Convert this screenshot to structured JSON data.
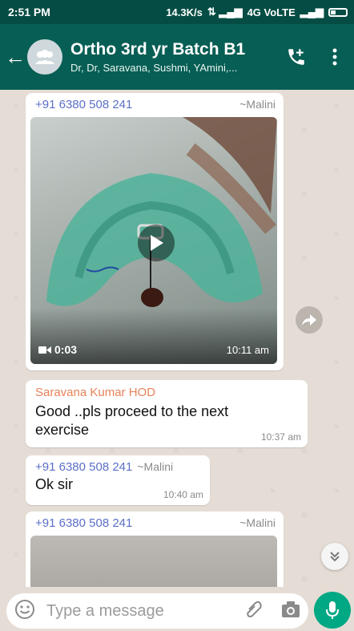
{
  "status_bar": {
    "time": "2:51 PM",
    "network": "14.3K/s",
    "signal_text": "4G VoLTE"
  },
  "header": {
    "title": "Ortho 3rd yr Batch B1",
    "subtitle": "Dr, Dr, Saravana, Sushmi, YAmini,..."
  },
  "messages": [
    {
      "sender": "+91 6380 508 241",
      "alias": "~Malini",
      "video_duration": "0:03",
      "time": "10:11 am"
    },
    {
      "sender": "Saravana Kumar HOD",
      "text": "Good ..pls proceed to the next exercise",
      "time": "10:37 am"
    },
    {
      "sender": "+91 6380 508 241",
      "alias": "~Malini",
      "text": "Ok sir",
      "time": "10:40 am"
    },
    {
      "sender": "+91 6380 508 241",
      "alias": "~Malini"
    }
  ],
  "input": {
    "placeholder": "Type a message"
  },
  "colors": {
    "header": "#075e54",
    "status_bar": "#054d44",
    "accent": "#00a884",
    "sender_hod": "#e8825a",
    "sender_num": "#5b6fc7"
  },
  "icons": [
    "back-arrow-icon",
    "group-avatar-icon",
    "add-call-icon",
    "more-vert-icon",
    "play-icon",
    "video-camera-icon",
    "forward-icon",
    "scroll-down-icon",
    "emoji-icon",
    "attach-icon",
    "camera-icon",
    "mic-icon"
  ]
}
